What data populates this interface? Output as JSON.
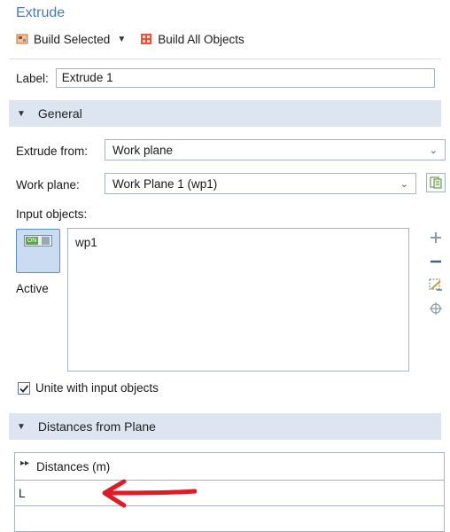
{
  "title": "Extrude",
  "toolbar": {
    "build_selected": "Build Selected",
    "build_all": "Build All Objects"
  },
  "label_row": {
    "label": "Label:",
    "value": "Extrude 1"
  },
  "general": {
    "header": "General",
    "extrude_from_label": "Extrude from:",
    "extrude_from_value": "Work plane",
    "work_plane_label": "Work plane:",
    "work_plane_value": "Work Plane 1 (wp1)",
    "input_objects_label": "Input objects:",
    "toggle_text": "ON",
    "active_label": "Active",
    "input_objects": [
      "wp1"
    ],
    "unite_label": "Unite with input objects",
    "unite_checked": true
  },
  "distances": {
    "header": "Distances from Plane",
    "column_header": "Distances (m)",
    "rows": [
      "L",
      ""
    ]
  },
  "colors": {
    "title": "#4a7bb5",
    "section_bg": "#dde6f0",
    "annotation_arrow": "#e01b24"
  }
}
